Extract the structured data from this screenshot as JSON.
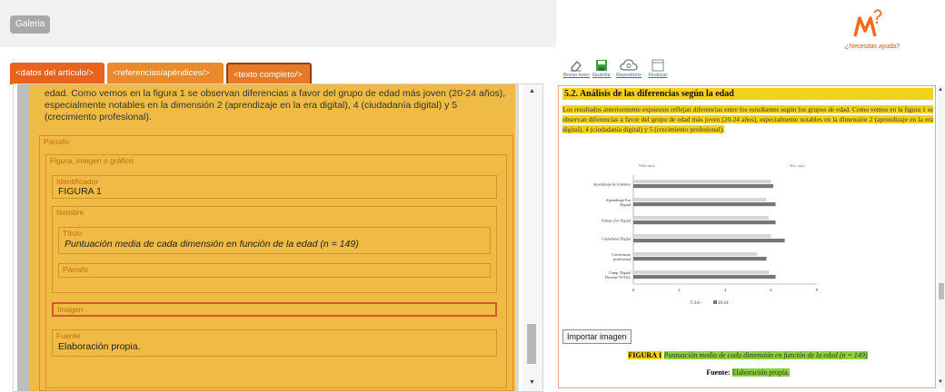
{
  "header": {
    "gallery_label": "Galeria",
    "help_label": "¿Necesitas ayuda?",
    "logo": {
      "letter": "M",
      "superscript": "?"
    }
  },
  "tabs": [
    {
      "label": "<datos del artículo/>"
    },
    {
      "label": "<referencias/apéndices/>"
    },
    {
      "label": "<texto completo/>"
    }
  ],
  "editor": {
    "paragraph_text": "edad. Como vemos en la figura 1 se observan diferencias a favor del grupo de edad más joven (20-24 años), especialmente notables en la dimensión 2 (aprendizaje en la era digital), 4 (ciudadanía digital) y 5 (crecimiento profesional).",
    "parrafo_label": "Párrafo",
    "figura_label": "Figura, imagen o gráfico",
    "identificador_label": "Identificador",
    "identificador_value": "FIGURA 1",
    "nombre_label": "Nombre",
    "titulo_label": "Título",
    "titulo_value": "Puntuación media de cada dimensión en función de la edad (n = 149)",
    "parrafo2_label": "Párrafo",
    "imagen_label": "Imagen",
    "fuente_label": "Fuente",
    "fuente_value": "Elaboración propia."
  },
  "toolbar": {
    "items": [
      {
        "label": "Borrar texto",
        "icon": "eraser-icon"
      },
      {
        "label": "Guardar",
        "icon": "save-icon"
      },
      {
        "label": "Repositorio",
        "icon": "cloud-icon"
      },
      {
        "label": "Finalizar",
        "icon": "window-icon"
      }
    ]
  },
  "preview": {
    "heading": "5.2. Análisis de las diferencias según la edad",
    "body": "Los resultados anteriormente expuestos reflejan diferencias entre los estudiantes según los grupos de edad. Como vemos en la figura 1 se observan diferencias a favor del grupo de edad más joven (20-24 años), especialmente notables en la dimensión 2 (aprendizaje en la era digital), 4 (ciudadanía digital) y 5 (crecimiento profesional).",
    "import_button": "Importar imagen",
    "figure_id": "FIGURA 1",
    "figure_title": "Puntuación media de cada dimensión en función de la edad (n = 149)",
    "fuente_label": "Fuente:",
    "fuente_value": "Elaboración propia."
  },
  "colors": {
    "card_bg": "#efbb45",
    "tab_orange": "#e8631d",
    "highlight_yellow": "#f4d21a",
    "highlight_green": "#8bd13c",
    "series_24plus": "#d6d6d6",
    "series_20_24": "#777777"
  },
  "chart_data": {
    "type": "bar",
    "orientation": "horizontal",
    "categories": [
      "Aprendizaje de Alumnos",
      "Aprendizaje Era Digital",
      "Trabajo Era Digital",
      "Ciudadanía Digital",
      "Crecimiento profesional",
      "Comp. Digital Docente TOTAL"
    ],
    "series": [
      {
        "name": "24+",
        "values": [
          6.0,
          5.8,
          5.9,
          6.0,
          5.4,
          5.9
        ]
      },
      {
        "name": "20-24",
        "values": [
          6.1,
          6.2,
          6.2,
          6.6,
          5.8,
          6.2
        ]
      }
    ],
    "xlim": [
      0,
      8
    ],
    "xticks": [
      0,
      2,
      4,
      6,
      8
    ],
    "legend_position": "bottom",
    "top_labels": [
      "Nada capaz",
      "Muy capaz"
    ],
    "grid": false
  }
}
